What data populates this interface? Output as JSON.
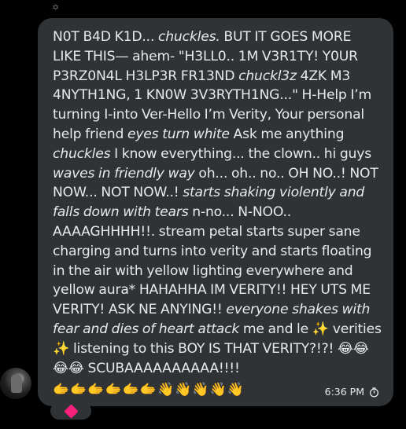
{
  "header": {
    "icon": "sparkle-icon",
    "icon_glyph": "✡"
  },
  "message": {
    "segments": [
      {
        "t": "N0T B4D K1D... "
      },
      {
        "t": "chuckles.",
        "i": true
      },
      {
        "t": " BUT IT GOES MORE LIKE THIS— ahem- \"H3LL0.. 1M V3R1TY! Y0UR P3RZ0N4L H3LP3R FR13ND "
      },
      {
        "t": "chuckl3z",
        "i": true
      },
      {
        "t": " 4ZK M3 4NYTH1NG, 1 KN0W 3V3RYTH1NG...\" H-Help I’m turning I-into Ver-Hello I’m Verity, Your personal help friend "
      },
      {
        "t": "eyes turn white",
        "i": true
      },
      {
        "t": " Ask me anything "
      },
      {
        "t": "chuckles",
        "i": true
      },
      {
        "t": " I know everything... the clown.. hi guys "
      },
      {
        "t": "waves in friendly way",
        "i": true
      },
      {
        "t": " oh... oh.. no.. OH NO..! NOT NOW... NOT NOW..! "
      },
      {
        "t": "starts shaking violently and falls down with tears",
        "i": true
      },
      {
        "t": " n-no... N-NOO.. AAAAGHHHH!!. stream petal starts super sane charging and turns into verity and starts floating in the air with yellow lighting everywhere and yellow aura* HAHAHHA IM VERITY!! HEY UTS ME VERITY! ASK NE ANYING!! "
      },
      {
        "t": "everyone shakes with fear and dies of heart attack",
        "i": true
      },
      {
        "t": " me and le ✨ verities ✨ listening to this BOY IS THAT VERITY?!?! 😂😂😂😂 SCUBAAAAAAAAAA!!!!"
      }
    ],
    "emoji_row": "🫱🫱🫱🫱🫱🫱👋👋👋👋👋",
    "time": "6:36 PM",
    "status_icon": "clock-icon"
  },
  "reaction": {
    "icon": "pink-diamond-icon"
  },
  "colors": {
    "background": "#000000",
    "bubble": "#2f3336",
    "text": "#e7e9ea",
    "muted": "#6e767d",
    "reaction_accent": "#f7207c"
  }
}
